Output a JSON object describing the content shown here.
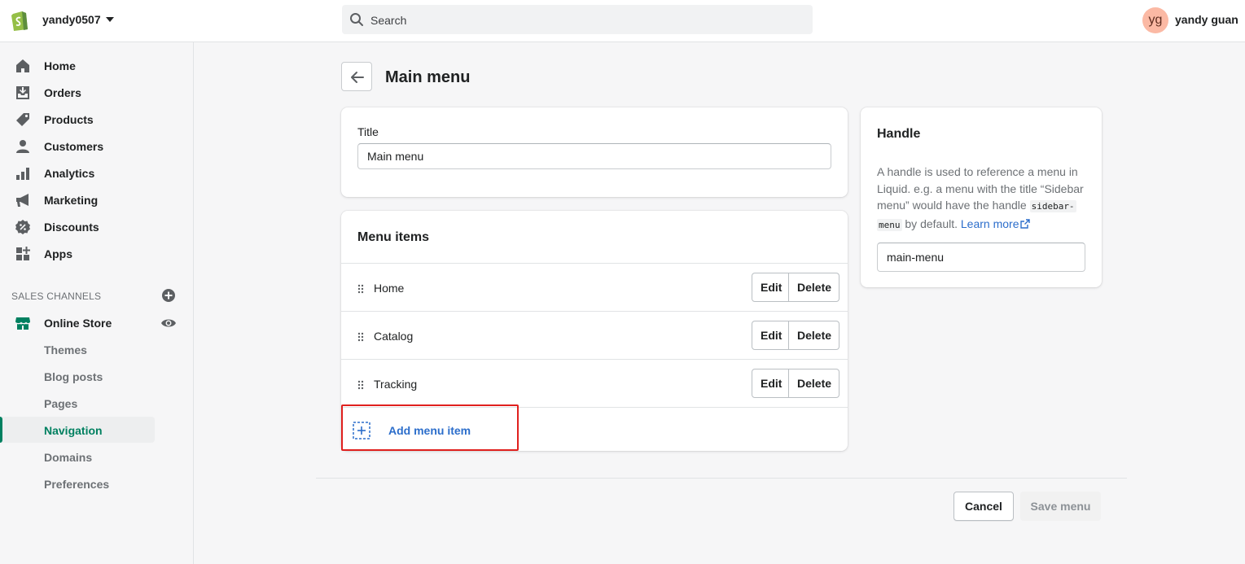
{
  "topbar": {
    "store_name": "yandy0507",
    "search_placeholder": "Search",
    "avatar_initials": "yg",
    "user_name": "yandy guan"
  },
  "sidebar": {
    "items": [
      {
        "label": "Home",
        "icon": "home-icon"
      },
      {
        "label": "Orders",
        "icon": "orders-icon"
      },
      {
        "label": "Products",
        "icon": "tag-icon"
      },
      {
        "label": "Customers",
        "icon": "person-icon"
      },
      {
        "label": "Analytics",
        "icon": "bar-chart-icon"
      },
      {
        "label": "Marketing",
        "icon": "megaphone-icon"
      },
      {
        "label": "Discounts",
        "icon": "discount-icon"
      },
      {
        "label": "Apps",
        "icon": "apps-icon"
      }
    ],
    "sales_channels_label": "SALES CHANNELS",
    "online_store_label": "Online Store",
    "sub_items": [
      "Themes",
      "Blog posts",
      "Pages",
      "Navigation",
      "Domains",
      "Preferences"
    ],
    "active_sub_item": "Navigation"
  },
  "page": {
    "title": "Main menu"
  },
  "title_card": {
    "label": "Title",
    "value": "Main menu"
  },
  "menu_items_card": {
    "heading": "Menu items",
    "rows": [
      {
        "label": "Home"
      },
      {
        "label": "Catalog"
      },
      {
        "label": "Tracking"
      }
    ],
    "edit_label": "Edit",
    "delete_label": "Delete",
    "add_label": "Add menu item"
  },
  "handle_card": {
    "heading": "Handle",
    "desc_part1": "A handle is used to reference a menu in Liquid. e.g. a menu with the title “Sidebar menu” would have the handle ",
    "desc_code1": "sidebar-",
    "desc_code2": "menu",
    "desc_part2": " by default. ",
    "learn_more": "Learn more",
    "value": "main-menu"
  },
  "footer": {
    "cancel_label": "Cancel",
    "save_label": "Save menu"
  },
  "colors": {
    "accent_green": "#008060",
    "link_blue": "#2c6ecb",
    "highlight_red": "#e0201e"
  }
}
